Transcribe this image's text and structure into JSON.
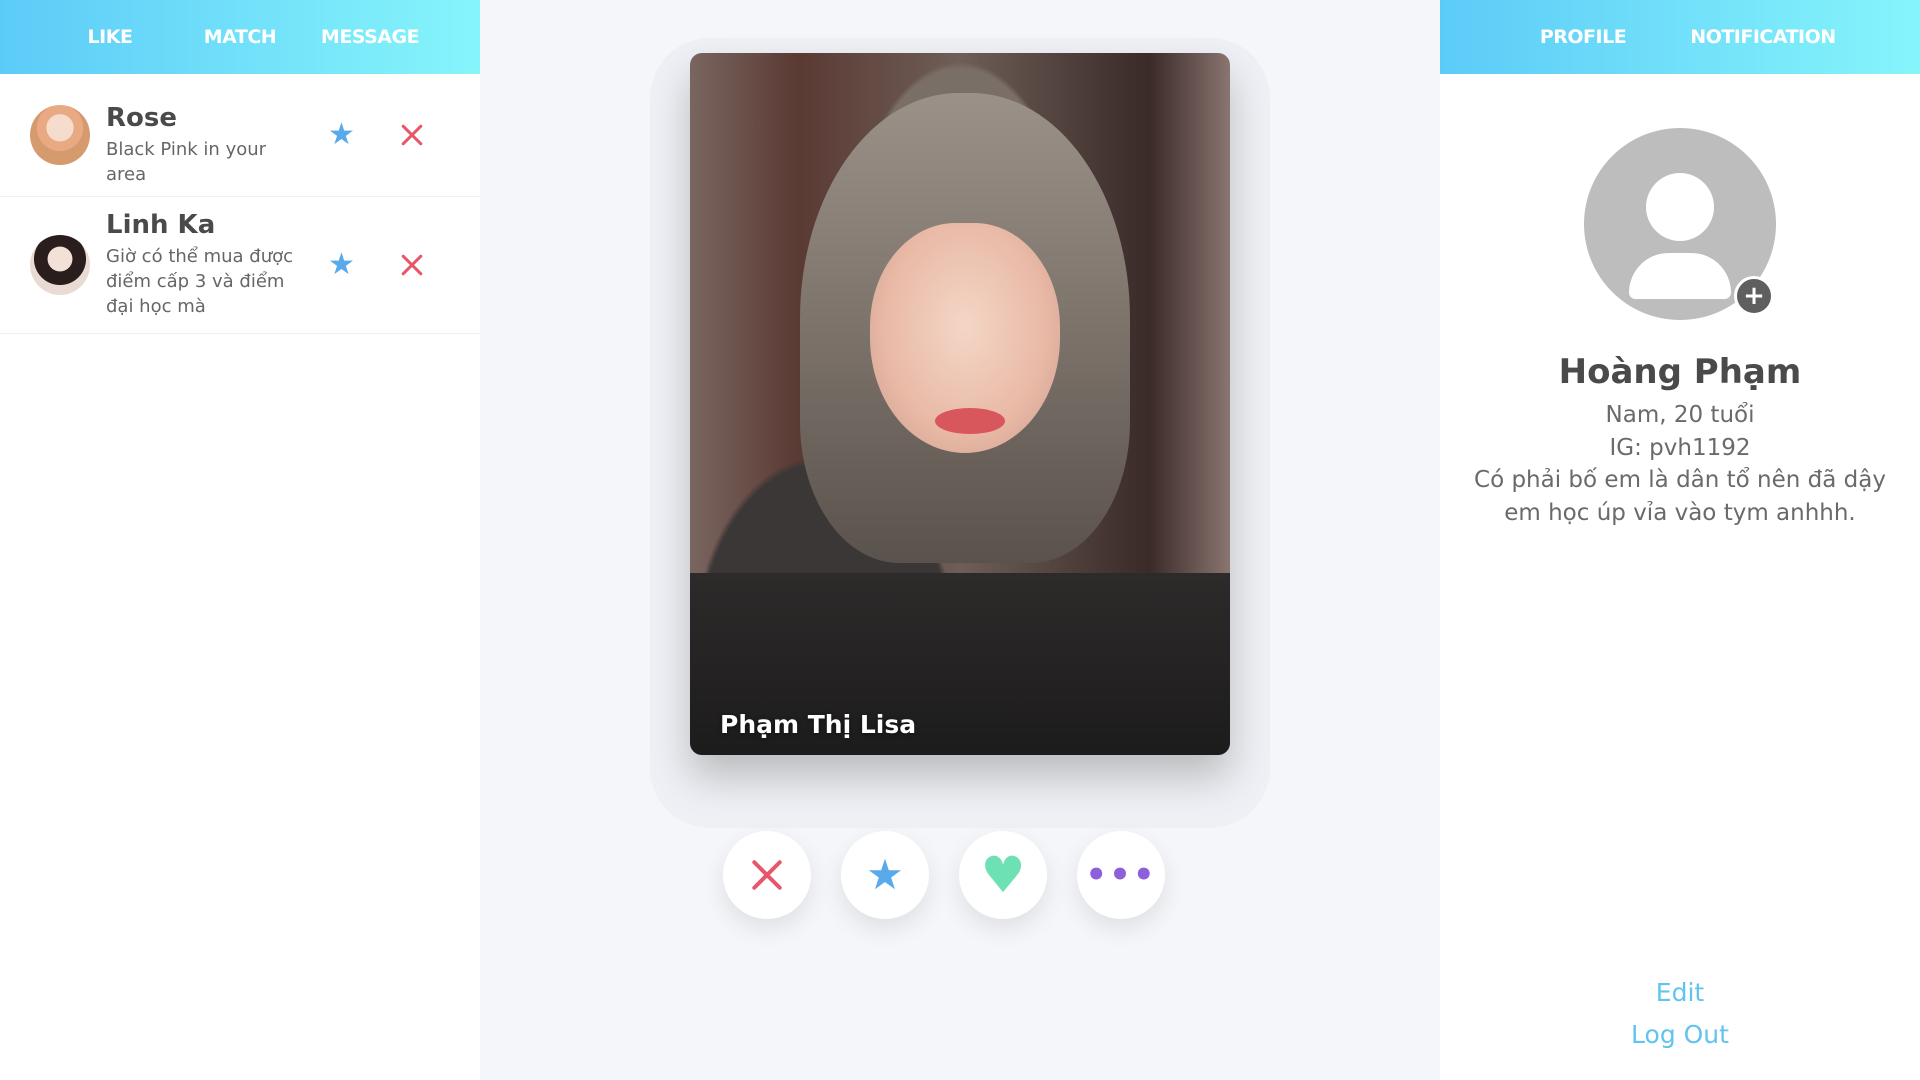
{
  "left_nav": {
    "tabs": [
      "LIKE",
      "MATCH",
      "MESSAGE"
    ]
  },
  "matches": [
    {
      "name": "Rose",
      "message": "Black Pink in your area",
      "avatar": "avatar-photo"
    },
    {
      "name": "Linh Ka",
      "message": "Giờ có thể mua được điểm cấp 3 và điểm đại học mà",
      "avatar": "avatar-photo"
    }
  ],
  "card": {
    "name": "Phạm Thị Lisa"
  },
  "actions": {
    "nope_icon": "close-icon",
    "super_like_icon": "star-icon",
    "like_icon": "heart-icon",
    "more_icon": "more-icon"
  },
  "right_nav": {
    "tabs": [
      "PROFILE",
      "NOTIFICATION"
    ]
  },
  "profile": {
    "name": "Hoàng Phạm",
    "gender_age": "Nam, 20 tuổi",
    "instagram": "IG: pvh1192",
    "bio": "Có phải bố em là dân tổ nên đã dậy em học úp vỉa vào tym anhhh.",
    "add_photo_symbol": "+",
    "edit_label": "Edit",
    "logout_label": "Log Out"
  },
  "colors": {
    "nav_gradient_start": "#5ccbf8",
    "nav_gradient_end": "#86f5fb",
    "star": "#5aa9ea",
    "close": "#e8566c",
    "heart": "#6de0b4",
    "more": "#8d5fd9",
    "link": "#62c4ee"
  }
}
